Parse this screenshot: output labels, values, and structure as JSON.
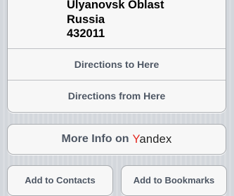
{
  "address": {
    "line1": "Ulyanovsk Oblast",
    "line2": "Russia",
    "line3": "432011"
  },
  "actions": {
    "directions_to": "Directions to Here",
    "directions_from": "Directions from Here"
  },
  "more_info": {
    "label": "More Info on",
    "brand_first_letter": "Y",
    "brand_rest": "andex",
    "brand_accent_color": "#e4261e"
  },
  "bottom_buttons": {
    "add_contacts": "Add to Contacts",
    "add_bookmarks": "Add to Bookmarks"
  }
}
